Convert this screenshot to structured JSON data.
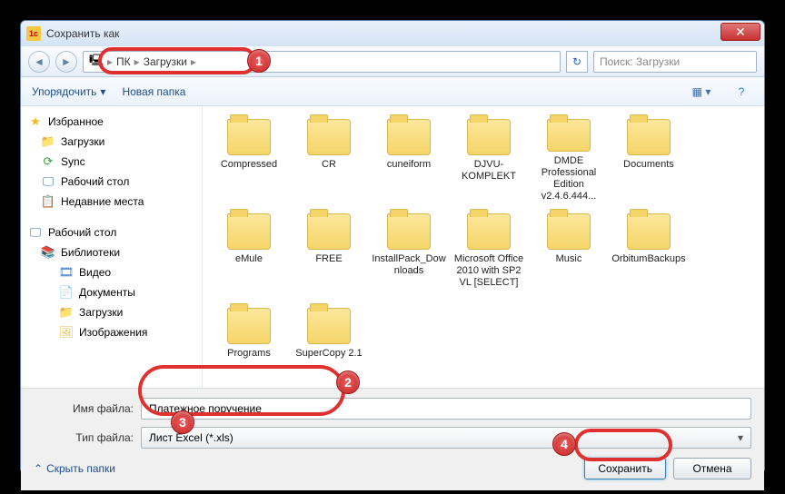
{
  "title": "Сохранить как",
  "breadcrumb": {
    "seg1": "ПК",
    "seg2": "Загрузки"
  },
  "search_placeholder": "Поиск: Загрузки",
  "toolbar": {
    "organize": "Упорядочить",
    "newfolder": "Новая папка"
  },
  "sidebar": {
    "favorites": "Избранное",
    "downloads": "Загрузки",
    "sync": "Sync",
    "desktop": "Рабочий стол",
    "recent": "Недавние места",
    "desktop2": "Рабочий стол",
    "libraries": "Библиотеки",
    "video": "Видео",
    "documents": "Документы",
    "downloads2": "Загрузки",
    "images": "Изображения"
  },
  "files": [
    {
      "name": "Compressed"
    },
    {
      "name": "CR"
    },
    {
      "name": "cuneiform"
    },
    {
      "name": "DJVU-KOMPLEKT"
    },
    {
      "name": "DMDE Professional Edition v2.4.6.444..."
    },
    {
      "name": "Documents"
    },
    {
      "name": "eMule"
    },
    {
      "name": "FREE"
    },
    {
      "name": "InstallPack_Downloads"
    },
    {
      "name": "Microsoft Office 2010 with SP2 VL [SELECT]"
    },
    {
      "name": "Music"
    },
    {
      "name": "OrbitumBackups"
    },
    {
      "name": "Programs"
    },
    {
      "name": "SuperCopy 2.1"
    }
  ],
  "filename_label": "Имя файла:",
  "filename_value": "Платежное поручение",
  "filetype_label": "Тип файла:",
  "filetype_value": "Лист Excel (*.xls)",
  "hide_folders": "Скрыть папки",
  "save_btn": "Сохранить",
  "cancel_btn": "Отмена",
  "markers": {
    "m1": "1",
    "m2": "2",
    "m3": "3",
    "m4": "4"
  }
}
